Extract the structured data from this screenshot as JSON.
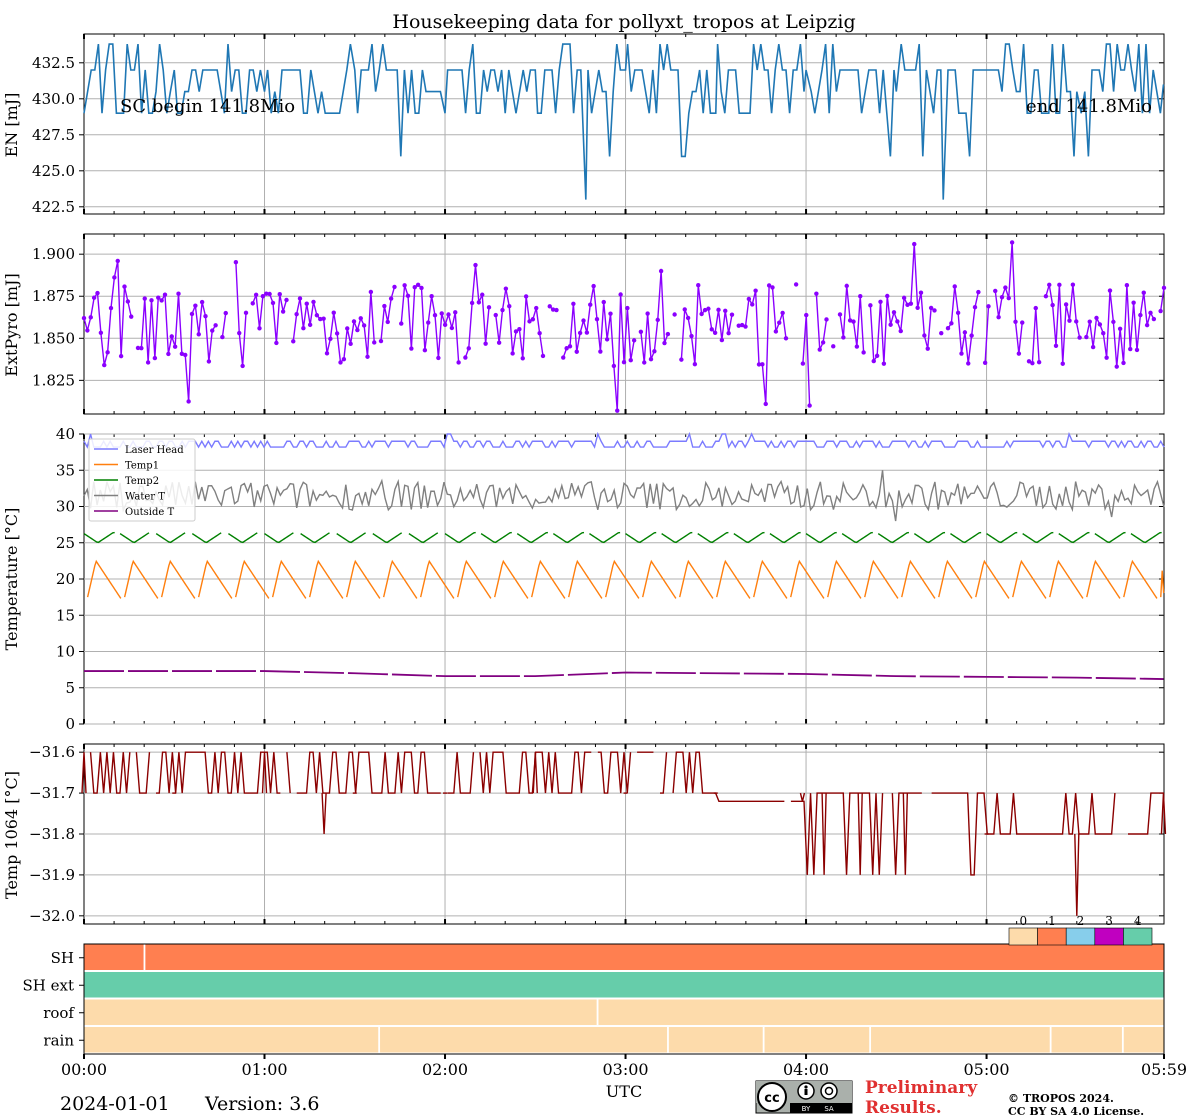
{
  "title": "Housekeeping data for pollyxt_tropos at Leipzig",
  "footer": {
    "date": "2024-01-01",
    "version": "Version: 3.6",
    "preliminary": "Preliminary\nResults.",
    "copyright_line1": "© TROPOS 2024.",
    "copyright_line2": "CC BY SA 4.0 License.",
    "cc_badge_text": "cc BY SA"
  },
  "colors": {
    "en": "#1f77b4",
    "pyro": "#8b00ff",
    "laser_head": "#7b7bff",
    "temp1": "#ff7f0e",
    "temp2": "#008000",
    "water": "#808080",
    "outside": "#800080",
    "temp1064": "#8b0000",
    "preliminary": "#e03030",
    "state0": "#fddbab",
    "state1": "#ff7f50",
    "state2": "#87ceeb",
    "state3": "#c000c0",
    "state4": "#66cdaa",
    "grid": "#b0b0b0"
  },
  "chart_data": [
    {
      "type": "line",
      "ylabel": "EN [mJ]",
      "ylim": [
        422.0,
        434.5
      ],
      "yticks": [
        "422.5",
        "425.0",
        "427.5",
        "430.0",
        "432.5"
      ],
      "xlim_hours": [
        0,
        5.983
      ],
      "annotations": [
        "SC begin 141.8Mio",
        "end 141.8Mio"
      ],
      "series": [
        {
          "values_levels": [
            429,
            430.5,
            432,
            433.8
          ],
          "x": [
            0.0,
            0.5,
            1.0,
            1.5,
            2.0,
            2.5,
            2.78,
            3.0,
            3.5,
            4.0,
            4.5,
            4.76,
            5.0,
            5.5,
            5.98
          ],
          "y": [
            429,
            432,
            430.5,
            432,
            429,
            432,
            423,
            432,
            429,
            432,
            430.5,
            423,
            432,
            430.5,
            431
          ]
        }
      ]
    },
    {
      "type": "line",
      "ylabel": "ExtPyro [mJ]",
      "ylim": [
        1.805,
        1.912
      ],
      "yticks": [
        "1.825",
        "1.850",
        "1.875",
        "1.900"
      ],
      "series": [
        {
          "x": [
            0.0,
            0.18,
            0.5,
            1.0,
            1.5,
            2.0,
            2.5,
            2.95,
            3.2,
            4.02,
            4.5,
            4.6,
            5.15,
            5.5,
            5.98
          ],
          "y": [
            1.862,
            1.896,
            1.845,
            1.875,
            1.86,
            1.858,
            1.868,
            1.807,
            1.89,
            1.81,
            1.86,
            1.906,
            1.907,
            1.86,
            1.88
          ]
        }
      ]
    },
    {
      "type": "line",
      "ylabel": "Temperature [$^\\circ C$]",
      "ylim": [
        0,
        40
      ],
      "yticks": [
        "0",
        "5",
        "10",
        "15",
        "20",
        "25",
        "30",
        "35",
        "40"
      ],
      "legend": [
        "Laser Head",
        "Temp1",
        "Temp2",
        "Water T",
        "Outside T"
      ],
      "legend_position": "upper-left",
      "series": [
        {
          "name": "Laser Head",
          "mean": 38.6,
          "range": [
            38.0,
            40.0
          ]
        },
        {
          "name": "Temp1",
          "mean": 19.5,
          "range": [
            17.0,
            23.0
          ]
        },
        {
          "name": "Temp2",
          "mean": 25.6,
          "range": [
            24.8,
            26.4
          ]
        },
        {
          "name": "Water T",
          "mean": 31.5,
          "range": [
            28.0,
            35.0
          ]
        },
        {
          "name": "Outside T",
          "x": [
            0.0,
            0.5,
            1.0,
            1.5,
            2.0,
            2.5,
            3.0,
            3.5,
            4.0,
            4.5,
            5.0,
            5.5,
            5.98
          ],
          "y": [
            7.3,
            7.3,
            7.3,
            7.0,
            6.6,
            6.6,
            7.1,
            7.0,
            6.9,
            6.6,
            6.5,
            6.4,
            6.2
          ]
        }
      ]
    },
    {
      "type": "line",
      "ylabel": "Temp 1064 [$^\\circ C$]",
      "ylim": [
        -32.02,
        -31.58
      ],
      "yticks": [
        "−32.0",
        "−31.9",
        "−31.8",
        "−31.7",
        "−31.6"
      ],
      "series": [
        {
          "x": [
            0.0,
            0.5,
            1.0,
            1.33,
            1.5,
            2.0,
            2.5,
            3.0,
            3.5,
            3.98,
            4.1,
            4.3,
            4.55,
            5.0,
            5.5,
            5.98
          ],
          "y": [
            -31.6,
            -31.7,
            -31.6,
            -31.8,
            -31.7,
            -31.7,
            -31.6,
            -31.7,
            -31.7,
            -31.72,
            -31.9,
            -31.9,
            -31.9,
            -31.8,
            -32.0,
            -31.7
          ]
        }
      ]
    },
    {
      "type": "heatmap",
      "rows": [
        "SH",
        "SH ext",
        "roof",
        "rain"
      ],
      "legend_ticks": [
        "0",
        "1",
        "2",
        "3",
        "4"
      ],
      "segments": {
        "SH": [
          {
            "start": 0.0,
            "end": 0.33,
            "state": 1
          },
          {
            "start": 0.34,
            "end": 5.983,
            "state": 1
          }
        ],
        "SH ext": [
          {
            "start": 0.0,
            "end": 5.983,
            "state": 4
          }
        ],
        "roof": [
          {
            "start": 0.0,
            "end": 2.84,
            "state": 0
          },
          {
            "start": 2.85,
            "end": 5.983,
            "state": 0
          }
        ],
        "rain": [
          {
            "start": 0.0,
            "end": 1.63,
            "state": 0
          },
          {
            "start": 1.64,
            "end": 3.23,
            "state": 0
          },
          {
            "start": 3.24,
            "end": 3.76,
            "state": 0
          },
          {
            "start": 3.77,
            "end": 4.35,
            "state": 0
          },
          {
            "start": 4.36,
            "end": 5.35,
            "state": 0
          },
          {
            "start": 5.36,
            "end": 5.75,
            "state": 0
          },
          {
            "start": 5.76,
            "end": 5.983,
            "state": 0
          }
        ]
      },
      "xlabel": "UTC",
      "xticks": [
        "00:00",
        "01:00",
        "02:00",
        "03:00",
        "04:00",
        "05:00",
        "05:59"
      ],
      "xtick_hours": [
        0,
        1,
        2,
        3,
        4,
        5,
        5.983
      ]
    }
  ]
}
